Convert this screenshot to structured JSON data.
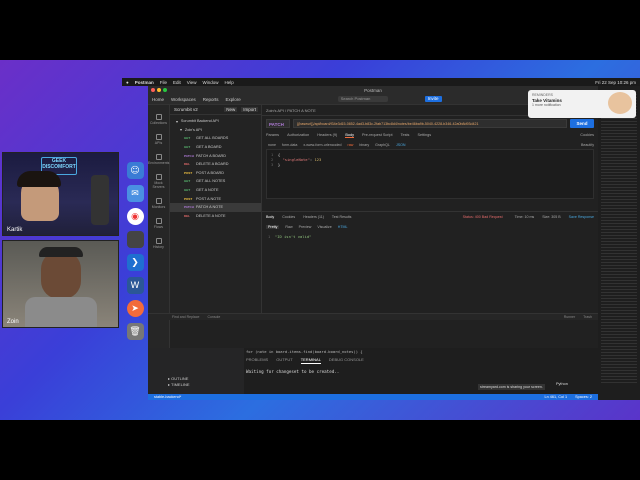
{
  "menubar": {
    "app": "Postman",
    "items": [
      "File",
      "Edit",
      "View",
      "Window",
      "Help"
    ],
    "clock": "Fri 22 Sep 10:26 pm"
  },
  "webcams": [
    {
      "name": "Kartik"
    },
    {
      "name": "Zoin"
    }
  ],
  "notification": {
    "app": "REMINDERS",
    "title": "Take Vitamins",
    "subtitle": "1 more notification"
  },
  "postman": {
    "window_title": "Postman",
    "top_nav": [
      "Home",
      "Workspaces",
      "Reports",
      "Explore"
    ],
    "search_placeholder": "Search Postman",
    "invite_label": "Invite",
    "workspace": "Scrumbit v2",
    "new_label": "New",
    "import_label": "Import",
    "rail": [
      "Collections",
      "APIs",
      "Environments",
      "Mock Servers",
      "Monitors",
      "Flows",
      "History"
    ],
    "collection_name": "Scrumbit Backend API",
    "collection_sub": "Zoin's API",
    "requests": [
      {
        "method": "GET",
        "name": "GET ALL BOARDS"
      },
      {
        "method": "GET",
        "name": "GET A BOARD"
      },
      {
        "method": "PATCH",
        "name": "PATCH A BOARD"
      },
      {
        "method": "DEL",
        "name": "DELETE A BOARD"
      },
      {
        "method": "POST",
        "name": "POST A BOARD"
      },
      {
        "method": "GET",
        "name": "GET ALL NOTES"
      },
      {
        "method": "GET",
        "name": "GET A NOTE"
      },
      {
        "method": "POST",
        "name": "POST A NOTE"
      },
      {
        "method": "PATCH",
        "name": "PATCH A NOTE"
      },
      {
        "method": "DEL",
        "name": "DELETE A NOTE"
      }
    ],
    "breadcrumb": "Zoin's API / PATCH A NOTE",
    "save_label": "Save",
    "method": "PATCH",
    "url": "{{baseurl}}/api/board/f34e3d15-0852-4ad3-b83c-2fab713bc8d4/notes/be46ba9b-5040-4228-b346-42a0b8d93d421",
    "send_label": "Send",
    "cookies_label": "Cookies",
    "beautify_label": "Beautify",
    "req_tabs": [
      "Params",
      "Authorization",
      "Headers (9)",
      "Body",
      "Pre-request Script",
      "Tests",
      "Settings"
    ],
    "body_options": [
      "none",
      "form-data",
      "x-www-form-urlencoded",
      "raw",
      "binary",
      "GraphQL",
      "JSON"
    ],
    "body_lines": [
      "1",
      "2",
      "3"
    ],
    "body_key": "\"singleNote\"",
    "body_value": "123",
    "resp_tabs": [
      "Body",
      "Cookies",
      "Headers (11)",
      "Test Results"
    ],
    "status": "Status: 400 Bad Request",
    "time": "Time: 10 ms",
    "size": "Size: 305 B",
    "save_response": "Save Response",
    "resp_formats": [
      "Pretty",
      "Raw",
      "Preview",
      "Visualize",
      "HTML"
    ],
    "resp_body": "\"ID isn't valid\"",
    "footer": [
      "Find and Replace",
      "Console",
      "Runner",
      "Trash"
    ]
  },
  "vscode": {
    "code_line": "for (note in board.items.find(board.board_notes)) {",
    "panel_tabs": [
      "PROBLEMS",
      "OUTPUT",
      "TERMINAL",
      "DEBUG CONSOLE"
    ],
    "terminal_line": "Waiting for changeset to be created..",
    "outline": "OUTLINE",
    "timeline": "TIMELINE",
    "branch": "stable-backend*",
    "position": "Ln 461, Col 1",
    "spaces": "Spaces: 2",
    "language": "Python",
    "streamyard": "streamyard.com is sharing your screen."
  }
}
